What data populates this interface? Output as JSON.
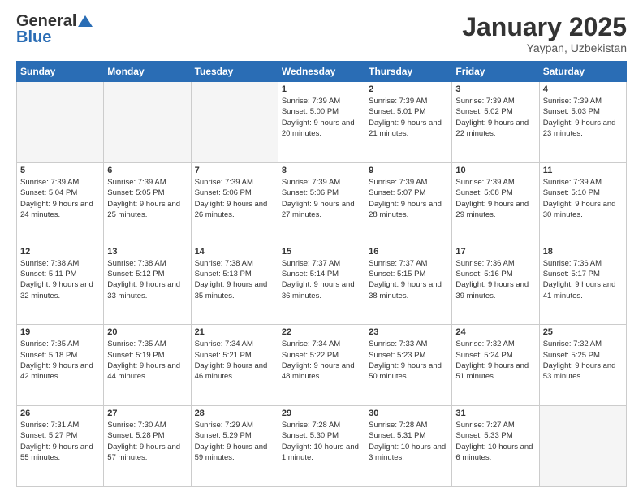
{
  "logo": {
    "general": "General",
    "blue": "Blue"
  },
  "header": {
    "month": "January 2025",
    "location": "Yaypan, Uzbekistan"
  },
  "weekdays": [
    "Sunday",
    "Monday",
    "Tuesday",
    "Wednesday",
    "Thursday",
    "Friday",
    "Saturday"
  ],
  "weeks": [
    [
      {
        "day": "",
        "empty": true
      },
      {
        "day": "",
        "empty": true
      },
      {
        "day": "",
        "empty": true
      },
      {
        "day": "1",
        "sunrise": "7:39 AM",
        "sunset": "5:00 PM",
        "daylight": "9 hours and 20 minutes."
      },
      {
        "day": "2",
        "sunrise": "7:39 AM",
        "sunset": "5:01 PM",
        "daylight": "9 hours and 21 minutes."
      },
      {
        "day": "3",
        "sunrise": "7:39 AM",
        "sunset": "5:02 PM",
        "daylight": "9 hours and 22 minutes."
      },
      {
        "day": "4",
        "sunrise": "7:39 AM",
        "sunset": "5:03 PM",
        "daylight": "9 hours and 23 minutes."
      }
    ],
    [
      {
        "day": "5",
        "sunrise": "7:39 AM",
        "sunset": "5:04 PM",
        "daylight": "9 hours and 24 minutes."
      },
      {
        "day": "6",
        "sunrise": "7:39 AM",
        "sunset": "5:05 PM",
        "daylight": "9 hours and 25 minutes."
      },
      {
        "day": "7",
        "sunrise": "7:39 AM",
        "sunset": "5:06 PM",
        "daylight": "9 hours and 26 minutes."
      },
      {
        "day": "8",
        "sunrise": "7:39 AM",
        "sunset": "5:06 PM",
        "daylight": "9 hours and 27 minutes."
      },
      {
        "day": "9",
        "sunrise": "7:39 AM",
        "sunset": "5:07 PM",
        "daylight": "9 hours and 28 minutes."
      },
      {
        "day": "10",
        "sunrise": "7:39 AM",
        "sunset": "5:08 PM",
        "daylight": "9 hours and 29 minutes."
      },
      {
        "day": "11",
        "sunrise": "7:39 AM",
        "sunset": "5:10 PM",
        "daylight": "9 hours and 30 minutes."
      }
    ],
    [
      {
        "day": "12",
        "sunrise": "7:38 AM",
        "sunset": "5:11 PM",
        "daylight": "9 hours and 32 minutes."
      },
      {
        "day": "13",
        "sunrise": "7:38 AM",
        "sunset": "5:12 PM",
        "daylight": "9 hours and 33 minutes."
      },
      {
        "day": "14",
        "sunrise": "7:38 AM",
        "sunset": "5:13 PM",
        "daylight": "9 hours and 35 minutes."
      },
      {
        "day": "15",
        "sunrise": "7:37 AM",
        "sunset": "5:14 PM",
        "daylight": "9 hours and 36 minutes."
      },
      {
        "day": "16",
        "sunrise": "7:37 AM",
        "sunset": "5:15 PM",
        "daylight": "9 hours and 38 minutes."
      },
      {
        "day": "17",
        "sunrise": "7:36 AM",
        "sunset": "5:16 PM",
        "daylight": "9 hours and 39 minutes."
      },
      {
        "day": "18",
        "sunrise": "7:36 AM",
        "sunset": "5:17 PM",
        "daylight": "9 hours and 41 minutes."
      }
    ],
    [
      {
        "day": "19",
        "sunrise": "7:35 AM",
        "sunset": "5:18 PM",
        "daylight": "9 hours and 42 minutes."
      },
      {
        "day": "20",
        "sunrise": "7:35 AM",
        "sunset": "5:19 PM",
        "daylight": "9 hours and 44 minutes."
      },
      {
        "day": "21",
        "sunrise": "7:34 AM",
        "sunset": "5:21 PM",
        "daylight": "9 hours and 46 minutes."
      },
      {
        "day": "22",
        "sunrise": "7:34 AM",
        "sunset": "5:22 PM",
        "daylight": "9 hours and 48 minutes."
      },
      {
        "day": "23",
        "sunrise": "7:33 AM",
        "sunset": "5:23 PM",
        "daylight": "9 hours and 50 minutes."
      },
      {
        "day": "24",
        "sunrise": "7:32 AM",
        "sunset": "5:24 PM",
        "daylight": "9 hours and 51 minutes."
      },
      {
        "day": "25",
        "sunrise": "7:32 AM",
        "sunset": "5:25 PM",
        "daylight": "9 hours and 53 minutes."
      }
    ],
    [
      {
        "day": "26",
        "sunrise": "7:31 AM",
        "sunset": "5:27 PM",
        "daylight": "9 hours and 55 minutes."
      },
      {
        "day": "27",
        "sunrise": "7:30 AM",
        "sunset": "5:28 PM",
        "daylight": "9 hours and 57 minutes."
      },
      {
        "day": "28",
        "sunrise": "7:29 AM",
        "sunset": "5:29 PM",
        "daylight": "9 hours and 59 minutes."
      },
      {
        "day": "29",
        "sunrise": "7:28 AM",
        "sunset": "5:30 PM",
        "daylight": "10 hours and 1 minute."
      },
      {
        "day": "30",
        "sunrise": "7:28 AM",
        "sunset": "5:31 PM",
        "daylight": "10 hours and 3 minutes."
      },
      {
        "day": "31",
        "sunrise": "7:27 AM",
        "sunset": "5:33 PM",
        "daylight": "10 hours and 6 minutes."
      },
      {
        "day": "",
        "empty": true
      }
    ]
  ]
}
